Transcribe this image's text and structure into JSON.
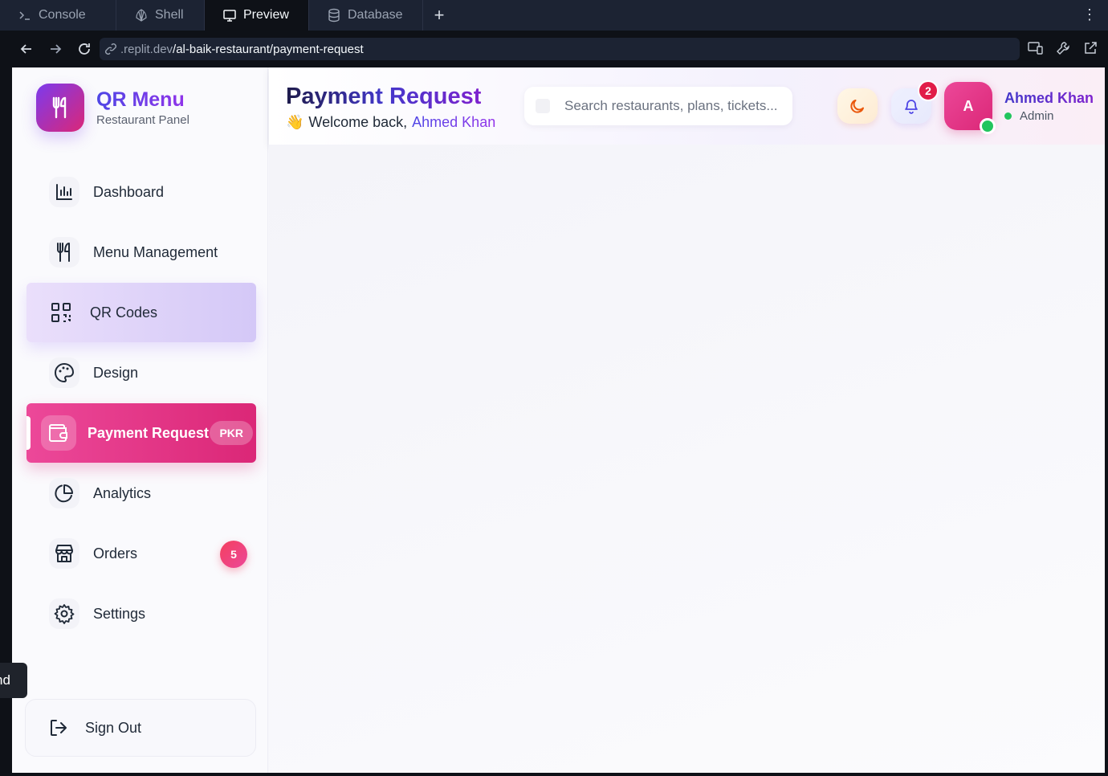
{
  "ide": {
    "tabs": [
      {
        "label": "Console",
        "icon": "terminal-icon"
      },
      {
        "label": "Shell",
        "icon": "shell-icon"
      },
      {
        "label": "Preview",
        "icon": "monitor-icon"
      },
      {
        "label": "Database",
        "icon": "database-icon"
      }
    ],
    "add_tab": "+",
    "url_host": ".replit.dev",
    "url_path": "/al-baik-restaurant/payment-request"
  },
  "brand": {
    "title": "QR Menu",
    "subtitle": "Restaurant Panel"
  },
  "nav": {
    "items": [
      {
        "label": "Dashboard",
        "icon": "bar-chart-icon"
      },
      {
        "label": "Menu Management",
        "icon": "utensils-icon"
      },
      {
        "label": "QR Codes",
        "icon": "qr-code-icon"
      },
      {
        "label": "Design",
        "icon": "palette-icon"
      },
      {
        "label": "Payment Request",
        "icon": "wallet-icon",
        "badge": "PKR",
        "active": true
      },
      {
        "label": "Analytics",
        "icon": "pie-chart-icon"
      },
      {
        "label": "Orders",
        "icon": "store-icon",
        "count": "5"
      },
      {
        "label": "Settings",
        "icon": "gear-icon"
      }
    ],
    "sign_out": "Sign Out"
  },
  "header": {
    "title": "Payment Request",
    "welcome_prefix": "Welcome back,",
    "welcome_name": "Ahmed Khan",
    "search_placeholder": "Search restaurants, plans, tickets...",
    "notification_count": "2",
    "avatar_initial": "A",
    "user_name": "Ahmed Khan",
    "user_role": "Admin"
  },
  "tooltip": {
    "text": "nd"
  },
  "colors": {
    "accent_indigo": "#4f46e5",
    "accent_purple": "#9333ea",
    "active_pink": "#db2777",
    "online_green": "#22c55e",
    "badge_red": "#e11d48"
  }
}
